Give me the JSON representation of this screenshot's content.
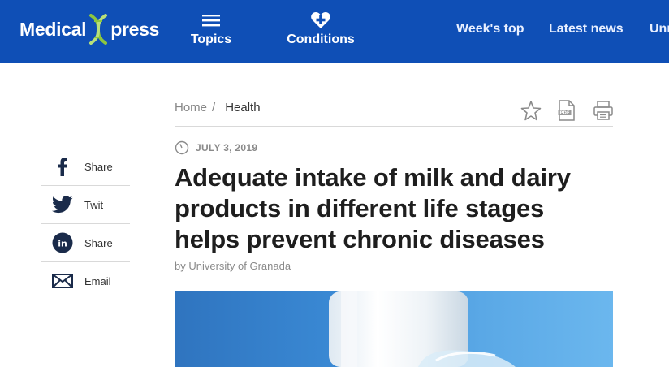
{
  "header": {
    "logo_left": "Medical",
    "logo_right": "press",
    "nav": {
      "topics": "Topics",
      "conditions": "Conditions",
      "weeks_top": "Week's top",
      "latest_news": "Latest news",
      "unread": "Unr"
    }
  },
  "breadcrumb": {
    "home": "Home",
    "separator": "/",
    "current": "Health"
  },
  "toolbar": {
    "icons": [
      "star-icon",
      "pdf-icon",
      "print-icon"
    ]
  },
  "article": {
    "date": "JULY 3, 2019",
    "title": "Adequate intake of milk and dairy products in different life stages helps prevent chronic diseases",
    "byline": "by University of Granada"
  },
  "share": {
    "items": [
      {
        "icon": "facebook-icon",
        "label": "Share"
      },
      {
        "icon": "twitter-icon",
        "label": "Twit"
      },
      {
        "icon": "linkedin-icon",
        "label": "Share"
      },
      {
        "icon": "email-icon",
        "label": "Email"
      }
    ]
  },
  "colors": {
    "brand": "#0f4fb6",
    "logo_accent": "#8dc63f"
  }
}
